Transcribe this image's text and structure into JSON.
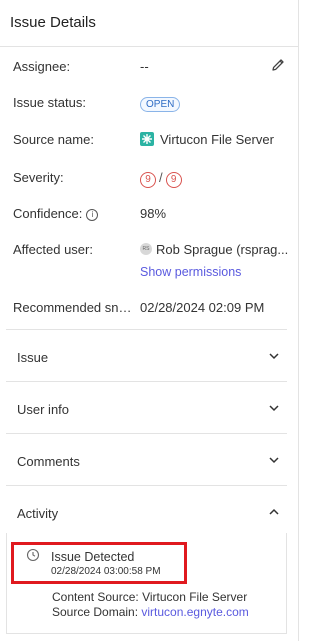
{
  "header": {
    "title": "Issue Details"
  },
  "fields": {
    "assignee": {
      "label": "Assignee:",
      "value": "--",
      "edit_icon": "pencil-icon"
    },
    "status": {
      "label": "Issue status:",
      "value": "OPEN"
    },
    "source": {
      "label": "Source name:",
      "value": "Virtucon File Server",
      "icon": "file-server-icon"
    },
    "severity": {
      "label": "Severity:",
      "value_a": "9",
      "separator": "/",
      "value_b": "9"
    },
    "confidence": {
      "label": "Confidence:",
      "info_icon": "i",
      "value": "98%"
    },
    "affected_user": {
      "label": "Affected user:",
      "avatar_initials": "RS",
      "value": "Rob Sprague (rsprag...",
      "show_permissions": "Show permissions"
    },
    "recommended": {
      "label": "Recommended sna...",
      "value": "02/28/2024 02:09 PM"
    }
  },
  "sections": [
    {
      "label": "Issue",
      "state": "collapsed"
    },
    {
      "label": "User info",
      "state": "collapsed"
    },
    {
      "label": "Comments",
      "state": "collapsed"
    },
    {
      "label": "Activity",
      "state": "expanded"
    }
  ],
  "activity": {
    "event_title": "Issue Detected",
    "event_time": "02/28/2024 03:00:58 PM",
    "content_source_label": "Content Source:",
    "content_source_value": "Virtucon File Server",
    "source_domain_label": "Source Domain:",
    "source_domain_value": "virtucon.egnyte.com"
  },
  "colors": {
    "accent_link": "#5a5adf",
    "status_blue": "#2d6bc4",
    "severity_red": "#d9534f",
    "highlight_red": "#e0191f",
    "source_icon_teal": "#2bb3a3"
  }
}
